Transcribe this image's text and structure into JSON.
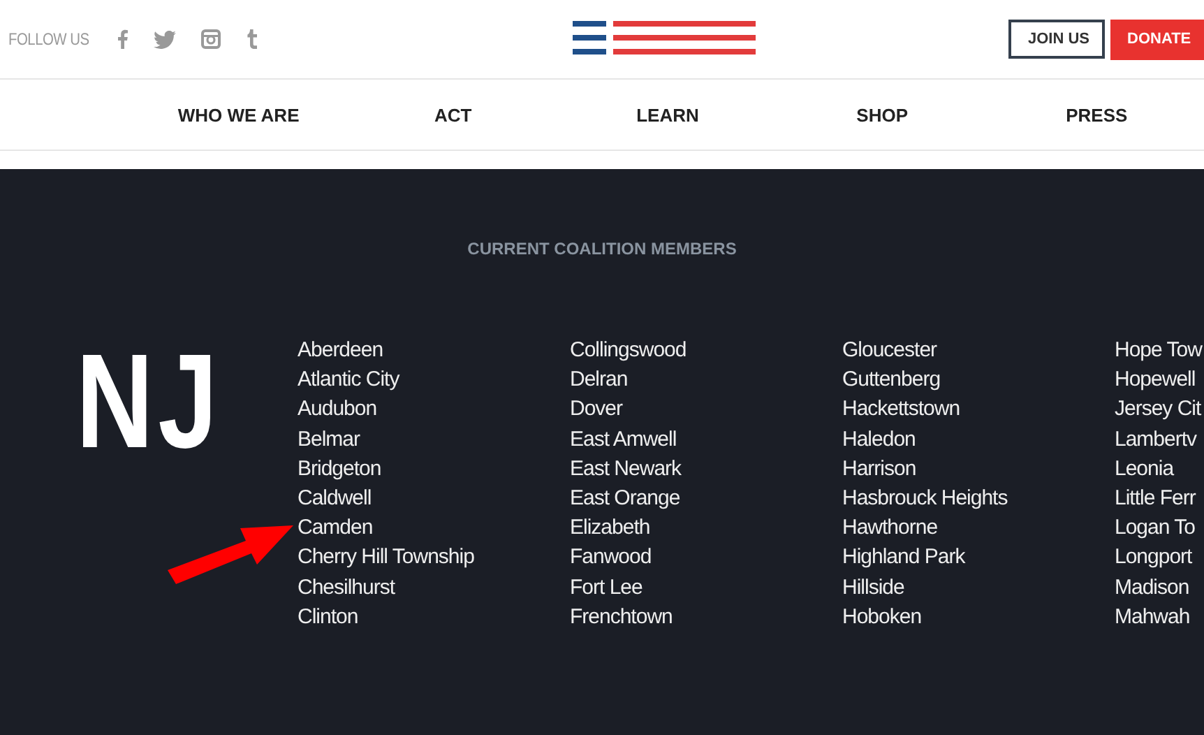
{
  "header": {
    "follow_label": "FOLLOW US",
    "buttons": [
      {
        "label": "JOIN US",
        "kind": "outline"
      },
      {
        "label": "DONATE",
        "kind": "filled"
      }
    ]
  },
  "nav": {
    "items": [
      "WHO WE ARE",
      "ACT",
      "LEARN",
      "SHOP",
      "PRESS"
    ]
  },
  "members": {
    "heading": "CURRENT COALITION MEMBERS",
    "state": "NJ",
    "columns": [
      [
        "Aberdeen",
        "Atlantic City",
        "Audubon",
        "Belmar",
        "Bridgeton",
        "Caldwell",
        "Camden",
        "Cherry Hill Township",
        "Chesilhurst",
        "Clinton"
      ],
      [
        "Collingswood",
        "Delran",
        "Dover",
        "East Amwell",
        "East Newark",
        "East Orange",
        "Elizabeth",
        "Fanwood",
        "Fort Lee",
        "Frenchtown"
      ],
      [
        "Gloucester",
        "Guttenberg",
        "Hackettstown",
        "Haledon",
        "Harrison",
        "Hasbrouck Heights",
        "Hawthorne",
        "Highland Park",
        "Hillside",
        "Hoboken"
      ],
      [
        "Hope Tow",
        "Hopewell",
        "Jersey Cit",
        "Lambertv",
        "Leonia",
        "Little Ferr",
        "Logan To",
        "Longport",
        "Madison",
        "Mahwah"
      ]
    ]
  }
}
